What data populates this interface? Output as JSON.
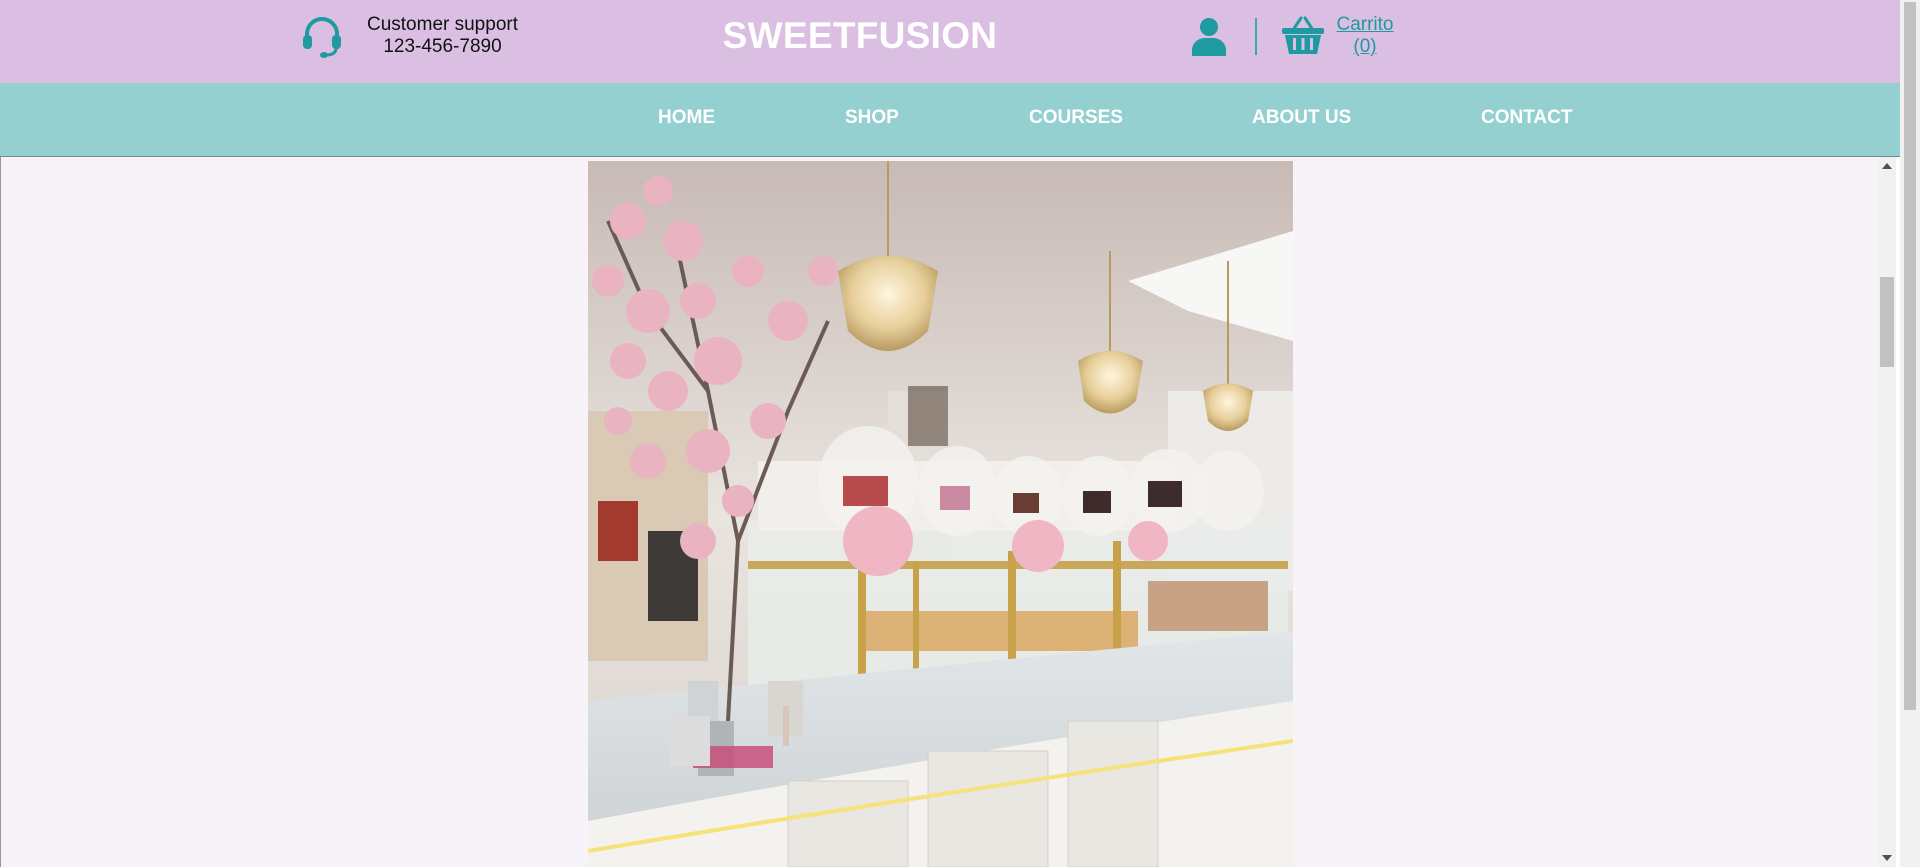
{
  "header": {
    "support_label": "Customer support",
    "support_phone": "123-456-7890",
    "brand": "SWEETFUSION",
    "cart_label": "Carrito",
    "cart_count": "(0)"
  },
  "nav": {
    "items": [
      {
        "label": "HOME"
      },
      {
        "label": "SHOP"
      },
      {
        "label": "COURSES"
      },
      {
        "label": "ABOUT US"
      },
      {
        "label": "CONTACT"
      }
    ]
  },
  "colors": {
    "header_bg": "#dbbfe3",
    "nav_bg": "#95d0d1",
    "accent_teal": "#1e9aa0",
    "content_bg": "#f8f2f9"
  },
  "icons": {
    "support": "headset-icon",
    "user": "user-icon",
    "cart": "basket-icon"
  }
}
